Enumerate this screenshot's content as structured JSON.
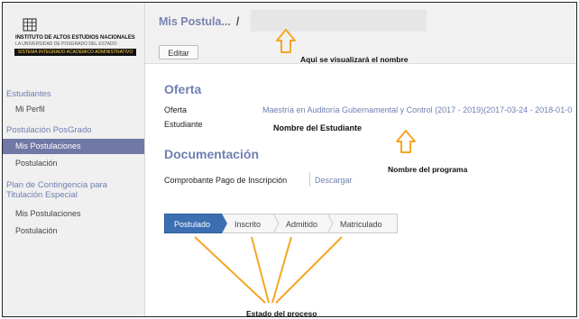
{
  "logo": {
    "title": "INSTITUTO DE ALTOS ESTUDIOS NACIONALES",
    "subtitle": "LA UNIVERSIDAD DE POSGRADO DEL ESTADO",
    "bar": "SISTEMA INTEGRADO ACADÉMICO ADMINISTRATIVO"
  },
  "sidebar": {
    "estudiantes": "Estudiantes",
    "mi_perfil": "Mi Perfil",
    "postulacion_posgrado": "Postulación PosGrado",
    "mis_postulaciones": "Mis Postulaciones",
    "postulacion": "Postulación",
    "plan": "Plan de Contingencia para Titulación Especial",
    "mis_postulaciones_2": "Mis Postulaciones",
    "postulacion_2": "Postulación"
  },
  "header": {
    "breadcrumb": "Mis Postula...",
    "separator": "/",
    "edit_label": "Editar"
  },
  "annotations": {
    "name_hint": "Aqui se visualizará el nombre",
    "student_hint": "Nombre del Estudiante",
    "program_hint": "Nombre del programa",
    "state_hint": "Estado del proceso"
  },
  "oferta": {
    "title": "Oferta",
    "oferta_label": "Oferta",
    "oferta_value": "Maestría en Auditoría Gubernamental y Control (2017 - 2019)(2017-03-24 - 2018-01-0",
    "estudiante_label": "Estudiante"
  },
  "documentacion": {
    "title": "Documentación",
    "pago_label": "Comprobante Pago de Inscripción",
    "descargar": "Descargar"
  },
  "steps": [
    "Postulado",
    "Inscrito",
    "Admitido",
    "Matriculado"
  ],
  "colors": {
    "accent": "#6e7fb0",
    "active_nav": "#7078a6",
    "active_step": "#3c6fb1",
    "annotation_arrow": "#f5a623"
  }
}
